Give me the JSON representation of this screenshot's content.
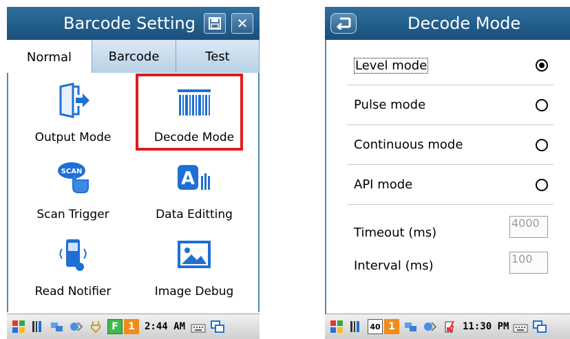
{
  "left": {
    "title": "Barcode Setting",
    "tabs": [
      "Normal",
      "Barcode",
      "Test"
    ],
    "tiles": [
      {
        "label": "Output Mode",
        "icon": "output-mode-icon"
      },
      {
        "label": "Decode Mode",
        "icon": "barcode-icon"
      },
      {
        "label": "Scan Trigger",
        "icon": "scan-trigger-icon"
      },
      {
        "label": "Data Editting",
        "icon": "data-edit-icon"
      },
      {
        "label": "Read Notifier",
        "icon": "read-notifier-icon"
      },
      {
        "label": "Image Debug",
        "icon": "image-icon"
      }
    ],
    "taskbar": {
      "time": "2:44 AM",
      "badge_f": "F",
      "badge_num": "1"
    }
  },
  "right": {
    "title": "Decode Mode",
    "modes": [
      {
        "label": "Level mode",
        "selected": true
      },
      {
        "label": "Pulse mode",
        "selected": false
      },
      {
        "label": "Continuous mode",
        "selected": false
      },
      {
        "label": "API mode",
        "selected": false
      }
    ],
    "timeout_label": "Timeout (ms)",
    "timeout_value": "4000",
    "interval_label": "Interval (ms)",
    "interval_value": "100",
    "taskbar": {
      "time": "11:30 PM",
      "badge_40": "40",
      "badge_num": "1"
    }
  },
  "colors": {
    "accent": "#2f6f9d",
    "highlight": "#e21b1b",
    "icon_blue": "#1e6fd6"
  }
}
